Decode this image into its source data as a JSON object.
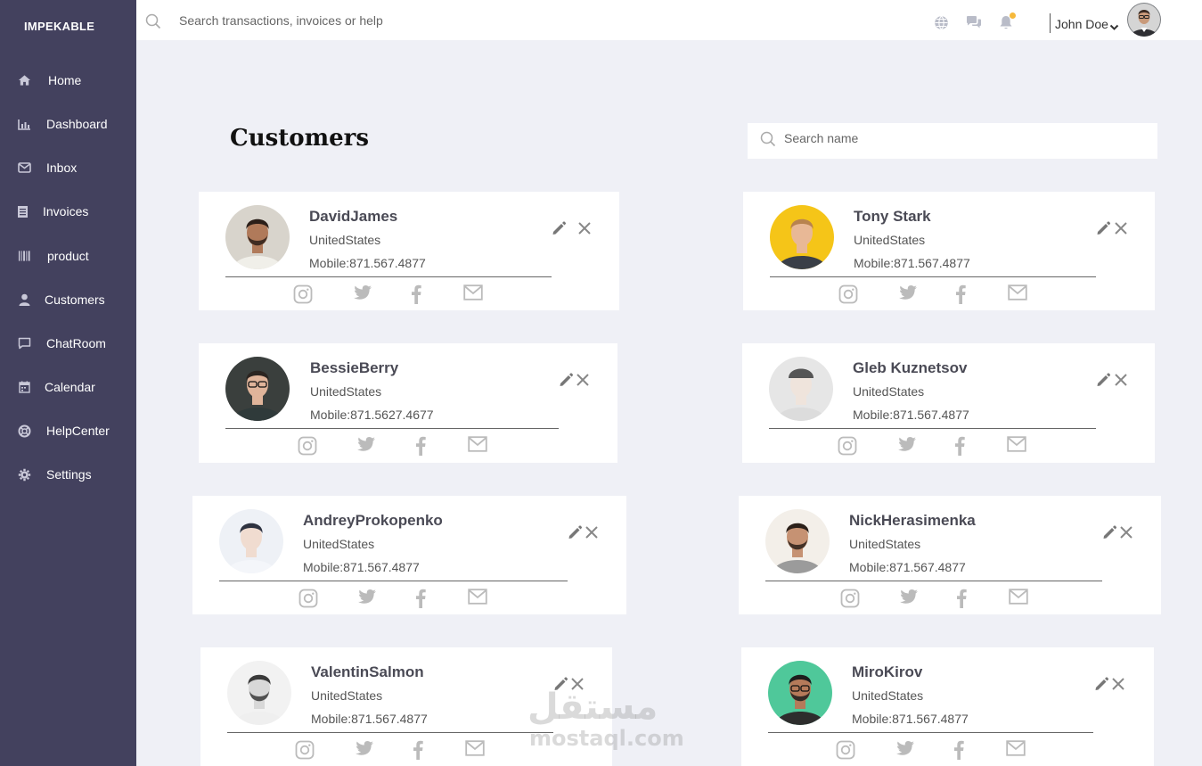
{
  "brand": "IMPEKABLE",
  "sidebar": {
    "items": [
      {
        "label": "Home",
        "icon": "home-icon"
      },
      {
        "label": "Dashboard",
        "icon": "bar-chart-icon"
      },
      {
        "label": "Inbox",
        "icon": "envelope-icon"
      },
      {
        "label": "Invoices",
        "icon": "invoice-icon"
      },
      {
        "label": "product",
        "icon": "barcode-icon"
      },
      {
        "label": "Customers",
        "icon": "user-icon"
      },
      {
        "label": "ChatRoom",
        "icon": "chat-bubble-icon"
      },
      {
        "label": "Calendar",
        "icon": "calendar-icon"
      },
      {
        "label": "HelpCenter",
        "icon": "lifebuoy-icon"
      },
      {
        "label": "Settings",
        "icon": "gear-icon"
      }
    ]
  },
  "topbar": {
    "search_placeholder": "Search transactions, invoices or help",
    "user_name": "John Doe",
    "notification_dot_color": "#f6b93b"
  },
  "page": {
    "title": "Customers",
    "search_placeholder": "Search name"
  },
  "customers": [
    {
      "name": "DavidJames",
      "country": "UnitedStates",
      "mobile": "Mobile:871.567.4877"
    },
    {
      "name": "Tony Stark",
      "country": "UnitedStates",
      "mobile": "Mobile:871.567.4877"
    },
    {
      "name": "BessieBerry",
      "country": "UnitedStates",
      "mobile": "Mobile:871.5627.4677"
    },
    {
      "name": "Gleb Kuznetsov",
      "country": "UnitedStates",
      "mobile": "Mobile:871.567.4877"
    },
    {
      "name": "AndreyProkopenko",
      "country": "UnitedStates",
      "mobile": "Mobile:871.567.4877"
    },
    {
      "name": "NickHerasimenka",
      "country": "UnitedStates",
      "mobile": "Mobile:871.567.4877"
    },
    {
      "name": "ValentinSalmon",
      "country": "UnitedStates",
      "mobile": "Mobile:871.567.4877"
    },
    {
      "name": "MiroKirov",
      "country": "UnitedStates",
      "mobile": "Mobile:871.567.4877"
    }
  ],
  "social_icons": [
    "instagram-icon",
    "twitter-icon",
    "facebook-icon",
    "mail-icon"
  ],
  "watermark": {
    "arabic": "مستقل",
    "latin": "mostaql.com"
  },
  "colors": {
    "sidebar": "#43415e",
    "background": "#eff0f6",
    "accent": "#f6b93b"
  }
}
